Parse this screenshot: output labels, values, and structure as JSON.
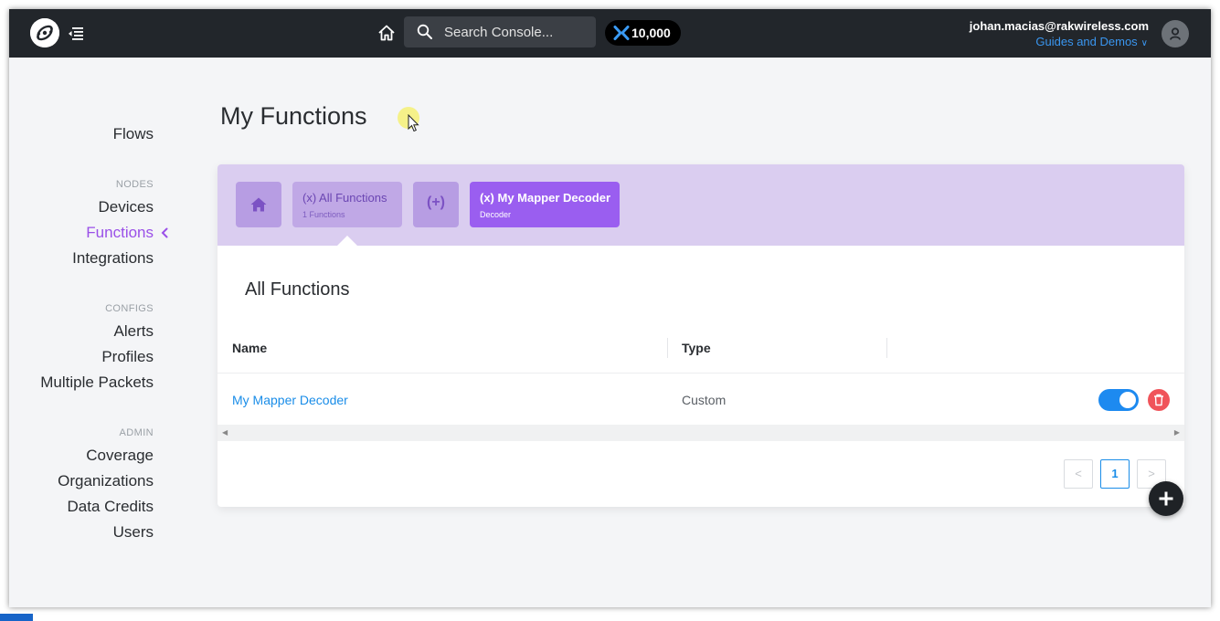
{
  "header": {
    "logo_icon": "helium-logo-icon",
    "menu_icon": "collapse-menu-icon",
    "home_icon": "home-icon",
    "search": {
      "placeholder": "Search Console...",
      "value": ""
    },
    "data_credits": "10,000",
    "user_email": "johan.macias@rakwireless.com",
    "guides_link": "Guides and Demos"
  },
  "sidebar": {
    "flows": "Flows",
    "nodes_section": "NODES",
    "devices": "Devices",
    "functions": "Functions",
    "integrations": "Integrations",
    "configs_section": "CONFIGS",
    "alerts": "Alerts",
    "profiles": "Profiles",
    "multiple_packets": "Multiple Packets",
    "admin_section": "ADMIN",
    "coverage": "Coverage",
    "organizations": "Organizations",
    "data_credits": "Data Credits",
    "users": "Users"
  },
  "main": {
    "page_title": "My Functions",
    "breadcrumbs": {
      "all_title": "(x) All Functions",
      "all_sub": "1 Functions",
      "add_label": "(+)",
      "active_title": "(x) My Mapper Decoder",
      "active_sub": "Decoder"
    },
    "section_title": "All Functions",
    "table": {
      "columns": [
        "Name",
        "Type"
      ],
      "rows": [
        {
          "name": "My Mapper Decoder",
          "type": "Custom",
          "active": true
        }
      ]
    },
    "pagination": {
      "prev": "<",
      "current": "1",
      "next": ">"
    }
  },
  "colors": {
    "topbar": "#22262b",
    "accent_purple": "#9a5ef0",
    "link_blue": "#1a8de8",
    "delete_red": "#f0545a"
  }
}
